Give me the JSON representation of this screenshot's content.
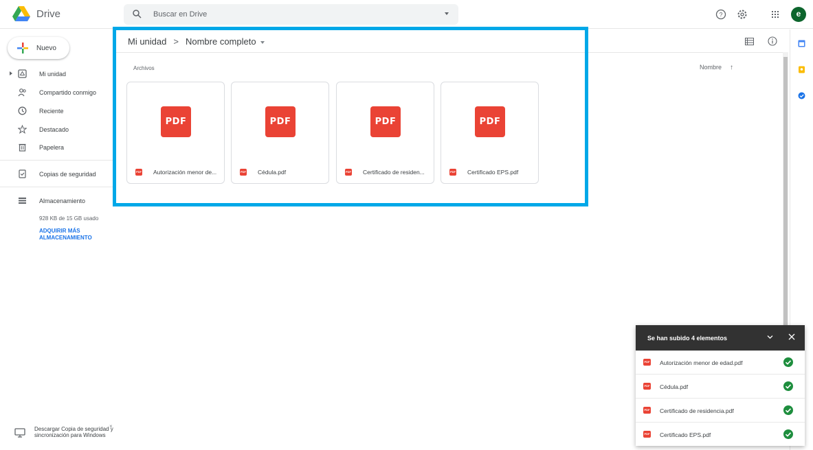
{
  "app": {
    "name": "Drive"
  },
  "search": {
    "placeholder": "Buscar en Drive"
  },
  "user": {
    "avatar_letter": "e"
  },
  "new_button": {
    "label": "Nuevo"
  },
  "sidebar": {
    "items": [
      {
        "label": "Mi unidad",
        "icon": "my-drive-icon"
      },
      {
        "label": "Compartido conmigo",
        "icon": "shared-icon"
      },
      {
        "label": "Reciente",
        "icon": "clock-icon"
      },
      {
        "label": "Destacado",
        "icon": "star-icon"
      },
      {
        "label": "Papelera",
        "icon": "trash-icon"
      },
      {
        "label": "Copias de seguridad",
        "icon": "backup-icon"
      },
      {
        "label": "Almacenamiento",
        "icon": "storage-icon"
      }
    ],
    "storage_usage": "928 KB de 15 GB usado",
    "storage_link": "ADQUIRIR MÁS ALMACENAMIENTO",
    "download_promo": "Descargar Copia de seguridad y sincronización para Windows"
  },
  "breadcrumb": {
    "root": "Mi unidad",
    "current": "Nombre completo"
  },
  "main": {
    "section_label": "Archivos",
    "sort_label": "Nombre",
    "files": [
      {
        "badge": "PDF",
        "name": "Autorización menor de..."
      },
      {
        "badge": "PDF",
        "name": "Cédula.pdf"
      },
      {
        "badge": "PDF",
        "name": "Certificado de residen..."
      },
      {
        "badge": "PDF",
        "name": "Certificado EPS.pdf"
      }
    ]
  },
  "upload_toast": {
    "title": "Se han subido 4 elementos",
    "items": [
      {
        "name": "Autorización menor de edad.pdf",
        "status": "complete"
      },
      {
        "name": "Cédula.pdf",
        "status": "complete"
      },
      {
        "name": "Certificado de residencia.pdf",
        "status": "complete"
      },
      {
        "name": "Certificado EPS.pdf",
        "status": "complete"
      }
    ]
  },
  "colors": {
    "accent": "#1a73e8",
    "pdf_red": "#ea4335",
    "highlight": "#00a8e8",
    "success": "#1e8e3e"
  }
}
